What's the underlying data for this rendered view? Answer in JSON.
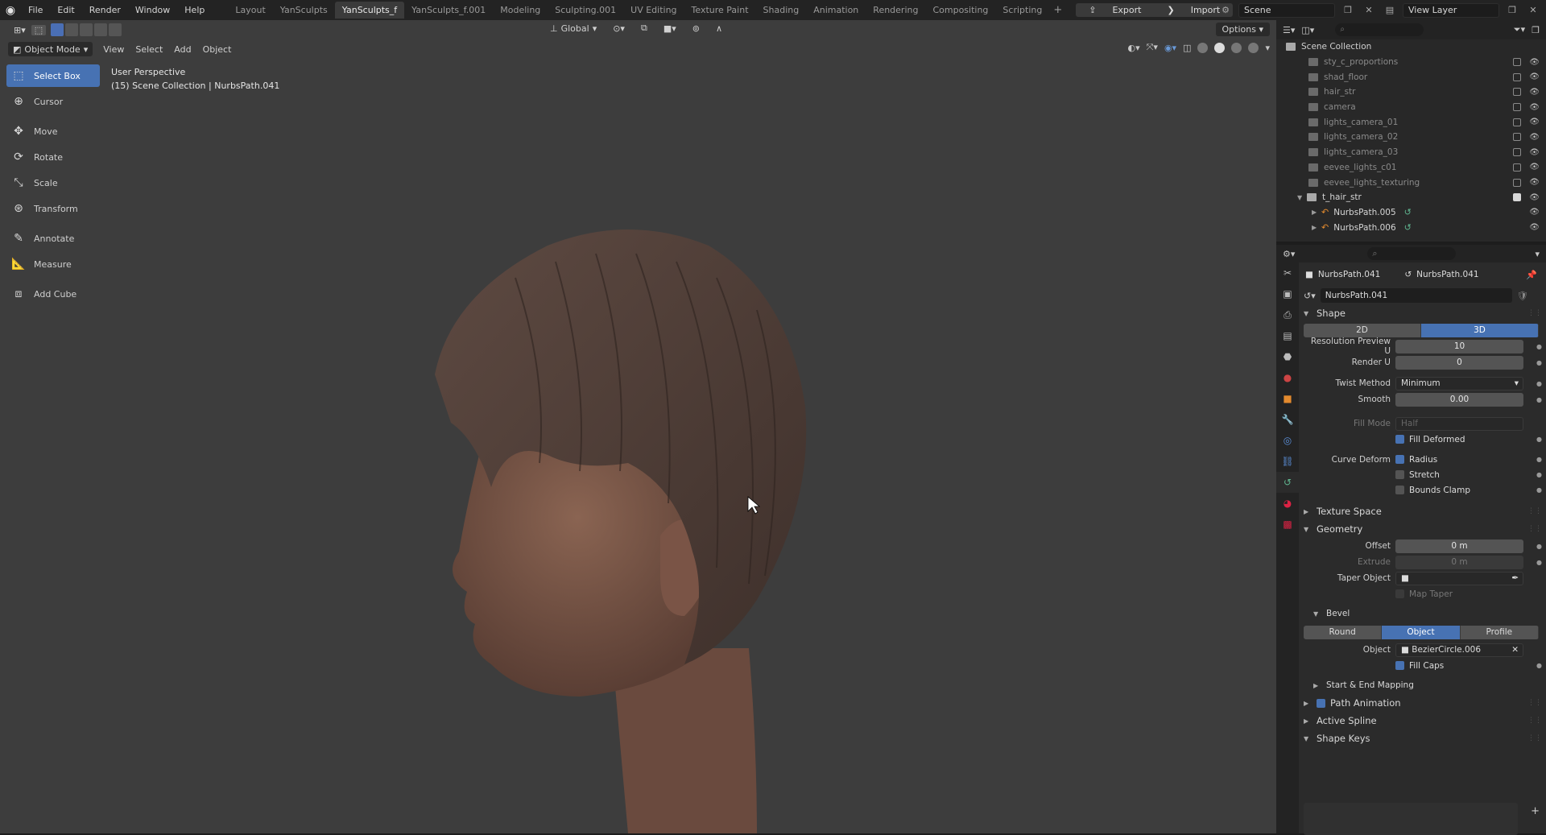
{
  "topbar": {
    "menus": [
      "File",
      "Edit",
      "Render",
      "Window",
      "Help"
    ],
    "workspaces": [
      "Layout",
      "YanSculpts",
      "YanSculpts_f",
      "YanSculpts_f.001",
      "Modeling",
      "Sculpting.001",
      "UV Editing",
      "Texture Paint",
      "Shading",
      "Animation",
      "Rendering",
      "Compositing",
      "Scripting"
    ],
    "active_workspace": "YanSculpts_f",
    "export_label": "Export",
    "import_label": "Import",
    "scene": "Scene",
    "view_layer": "View Layer"
  },
  "viewport": {
    "mode": "Object Mode",
    "menus": [
      "View",
      "Select",
      "Add",
      "Object"
    ],
    "transform_orientation": "Global",
    "options_label": "Options",
    "info_line1": "User Perspective",
    "info_line2": "(15) Scene Collection | NurbsPath.041",
    "tools": [
      {
        "label": "Select Box",
        "icon": "select-box-icon",
        "active": true
      },
      {
        "label": "Cursor",
        "icon": "cursor-icon"
      },
      {
        "label": "Move",
        "icon": "move-icon"
      },
      {
        "label": "Rotate",
        "icon": "rotate-icon"
      },
      {
        "label": "Scale",
        "icon": "scale-icon"
      },
      {
        "label": "Transform",
        "icon": "transform-icon"
      },
      {
        "label": "Annotate",
        "icon": "annotate-icon"
      },
      {
        "label": "Measure",
        "icon": "measure-icon"
      },
      {
        "label": "Add Cube",
        "icon": "add-cube-icon"
      }
    ]
  },
  "outliner": {
    "root": "Scene Collection",
    "collections": [
      "sty_c_proportions",
      "shad_floor",
      "hair_str",
      "camera",
      "lights_camera_01",
      "lights_camera_02",
      "lights_camera_03",
      "eevee_lights_c01",
      "eevee_lights_texturing"
    ],
    "active_collection": "t_hair_str",
    "children": [
      "NurbsPath.005",
      "NurbsPath.006"
    ]
  },
  "properties": {
    "object_name": "NurbsPath.041",
    "data_name": "NurbsPath.041",
    "datablock": "NurbsPath.041",
    "shape": {
      "title": "Shape",
      "dim_2d": "2D",
      "dim_3d": "3D",
      "resolution_preview_u_label": "Resolution Preview U",
      "resolution_preview_u": "10",
      "render_u_label": "Render U",
      "render_u": "0",
      "twist_method_label": "Twist Method",
      "twist_method": "Minimum",
      "smooth_label": "Smooth",
      "smooth": "0.00",
      "fill_mode_label": "Fill Mode",
      "fill_mode": "Half",
      "fill_deformed": "Fill Deformed",
      "curve_deform_label": "Curve Deform",
      "radius": "Radius",
      "stretch": "Stretch",
      "bounds_clamp": "Bounds Clamp"
    },
    "texture_space": "Texture Space",
    "geometry": {
      "title": "Geometry",
      "offset_label": "Offset",
      "offset": "0 m",
      "extrude_label": "Extrude",
      "extrude": "0 m",
      "taper_object_label": "Taper Object",
      "map_taper": "Map Taper"
    },
    "bevel": {
      "title": "Bevel",
      "modes": [
        "Round",
        "Object",
        "Profile"
      ],
      "active_mode": "Object",
      "object_label": "Object",
      "object": "BezierCircle.006",
      "fill_caps": "Fill Caps"
    },
    "start_end_mapping": "Start & End Mapping",
    "path_animation": "Path Animation",
    "active_spline": "Active Spline",
    "shape_keys": "Shape Keys"
  },
  "colors": {
    "accent": "#4772b3",
    "viewport_bg": "#3d3d3d",
    "curve_orange": "#e38a2e"
  }
}
